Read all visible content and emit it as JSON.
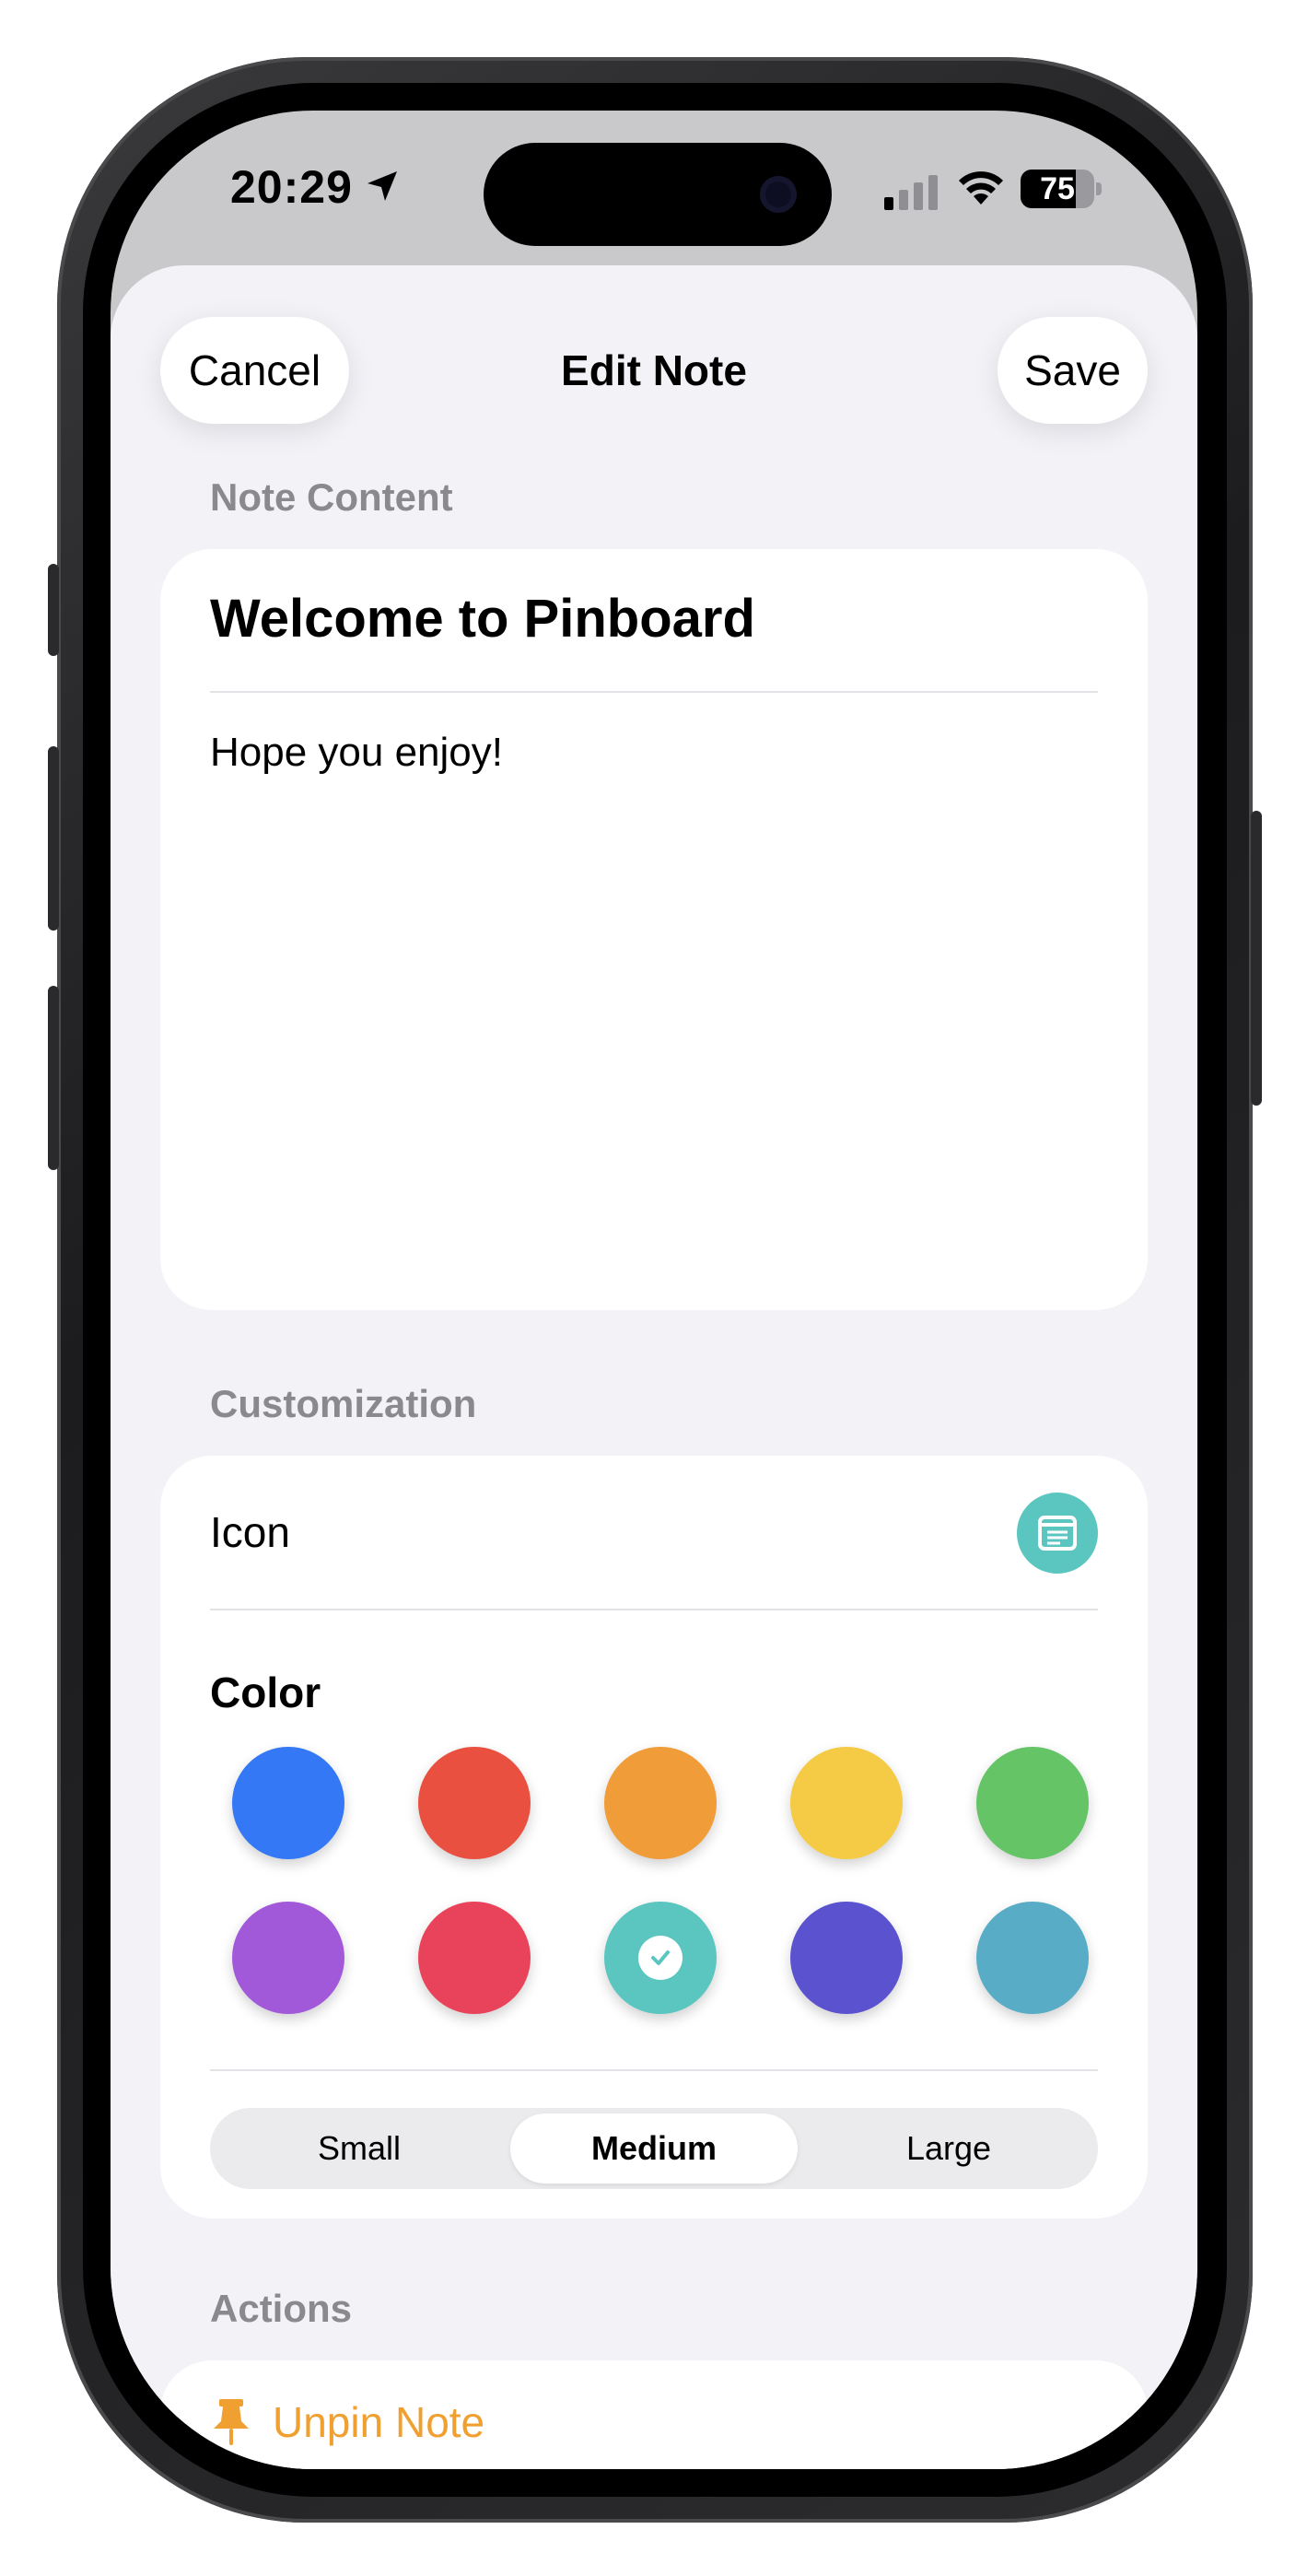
{
  "status_bar": {
    "time": "20:29",
    "battery": "75",
    "battery_level": 0.75
  },
  "nav": {
    "cancel_label": "Cancel",
    "title": "Edit Note",
    "save_label": "Save"
  },
  "note_section": {
    "label": "Note Content",
    "title": "Welcome to Pinboard",
    "body": "Hope you enjoy!"
  },
  "customization": {
    "label": "Customization",
    "icon_label": "Icon",
    "icon_name": "note-text-icon",
    "color_label": "Color",
    "colors": [
      "#3478f6",
      "#e9503f",
      "#f09c38",
      "#f5cb46",
      "#64c466",
      "#a259d9",
      "#e8435a",
      "#5bc6c0",
      "#5a52cf",
      "#58acc5"
    ],
    "selected_color_index": 7,
    "sizes": [
      "Small",
      "Medium",
      "Large"
    ],
    "selected_size": "Medium"
  },
  "actions": {
    "label": "Actions",
    "unpin_label": "Unpin Note",
    "unpin_icon": "pin-icon",
    "accent_color": "#f0a030"
  }
}
